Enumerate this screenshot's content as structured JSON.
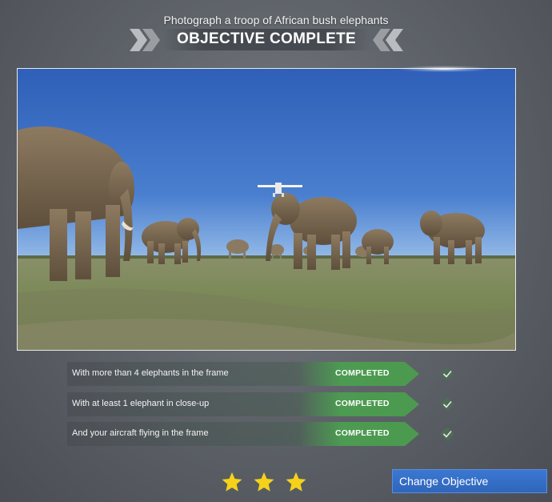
{
  "header": {
    "subtitle": "Photograph a troop of African bush elephants",
    "title": "OBJECTIVE COMPLETE"
  },
  "objectives": [
    {
      "label": "With more than 4 elephants in the frame",
      "status": "COMPLETED"
    },
    {
      "label": "With at least 1 elephant in close-up",
      "status": "COMPLETED"
    },
    {
      "label": "And your aircraft flying in the frame",
      "status": "COMPLETED"
    }
  ],
  "rating": {
    "stars": 3,
    "max": 3
  },
  "actions": {
    "change_objective": "Change Objective"
  },
  "colors": {
    "completed_green": "#4c9a4f",
    "star_yellow": "#f5d21a",
    "button_blue": "#3470c7",
    "chevron_grey": "#b9bcc0"
  }
}
